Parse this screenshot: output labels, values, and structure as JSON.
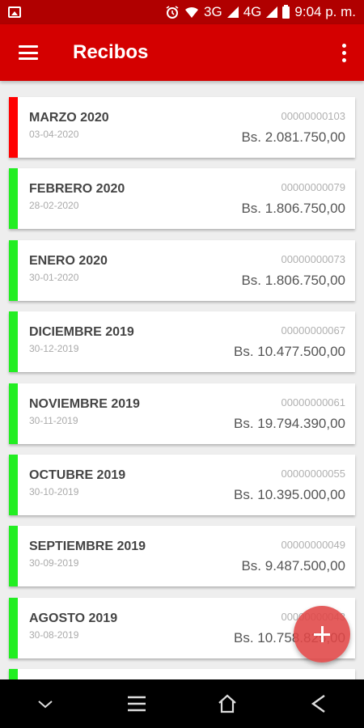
{
  "status_bar": {
    "time": "9:04 p. m.",
    "network_1": "3G",
    "network_2": "4G",
    "icons": [
      "image-icon",
      "alarm-icon",
      "wifi-icon",
      "signal-icon",
      "signal-icon",
      "battery-icon"
    ]
  },
  "app_bar": {
    "title": "Recibos",
    "menu_icon": "hamburger-menu-icon",
    "more_icon": "more-vertical-icon"
  },
  "colors": {
    "status_bar": "#b00000",
    "app_bar": "#d40000",
    "unpaid": "#ff0000",
    "paid": "#22ee22",
    "fab": "#e04646"
  },
  "receipts": [
    {
      "month": "MARZO 2020",
      "date": "03-04-2020",
      "number": "00000000103",
      "amount": "Bs. 2.081.750,00",
      "status": "unpaid"
    },
    {
      "month": "FEBRERO 2020",
      "date": "28-02-2020",
      "number": "00000000079",
      "amount": "Bs. 1.806.750,00",
      "status": "paid"
    },
    {
      "month": "ENERO 2020",
      "date": "30-01-2020",
      "number": "00000000073",
      "amount": "Bs. 1.806.750,00",
      "status": "paid"
    },
    {
      "month": "DICIEMBRE 2019",
      "date": "30-12-2019",
      "number": "00000000067",
      "amount": "Bs. 10.477.500,00",
      "status": "paid"
    },
    {
      "month": "NOVIEMBRE 2019",
      "date": "30-11-2019",
      "number": "00000000061",
      "amount": "Bs. 19.794.390,00",
      "status": "paid"
    },
    {
      "month": "OCTUBRE 2019",
      "date": "30-10-2019",
      "number": "00000000055",
      "amount": "Bs. 10.395.000,00",
      "status": "paid"
    },
    {
      "month": "SEPTIEMBRE 2019",
      "date": "30-09-2019",
      "number": "00000000049",
      "amount": "Bs. 9.487.500,00",
      "status": "paid"
    },
    {
      "month": "AGOSTO 2019",
      "date": "30-08-2019",
      "number": "00000000043",
      "amount": "Bs. 10.758.825,00",
      "status": "paid"
    },
    {
      "month": "",
      "date": "",
      "number": "",
      "amount": "",
      "status": "paid"
    }
  ],
  "fab": {
    "icon": "plus-icon"
  },
  "nav_bar": {
    "icons": [
      "chevron-down-icon",
      "menu-icon",
      "home-icon",
      "back-icon"
    ]
  }
}
